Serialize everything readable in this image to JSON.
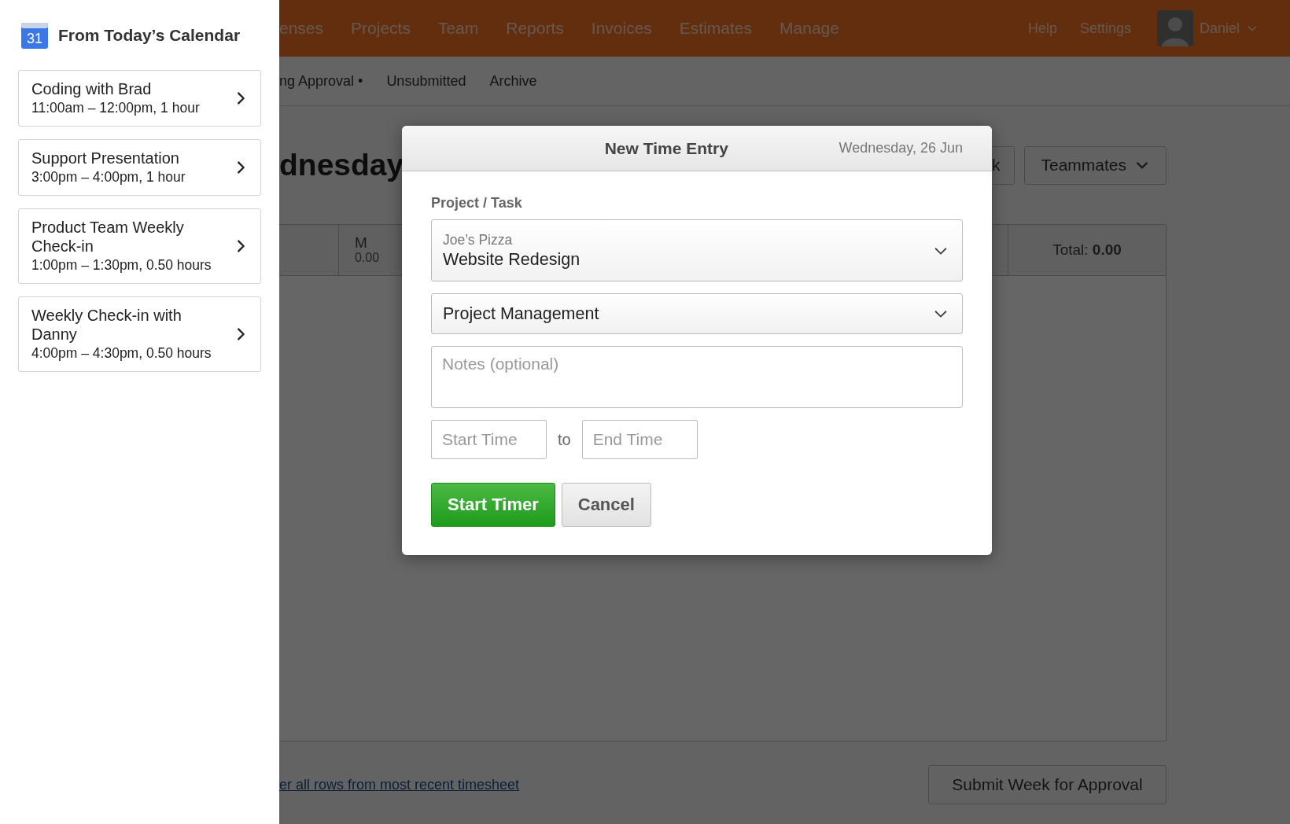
{
  "sidebar": {
    "title": "From Today’s Calendar",
    "icon_day": "31",
    "events": [
      {
        "title": "Coding with Brad",
        "time": "11:00am – 12:00pm, 1 hour"
      },
      {
        "title": "Support Presentation",
        "time": "3:00pm – 4:00pm, 1 hour"
      },
      {
        "title": "Product Team Weekly Check-in",
        "time": "1:00pm – 1:30pm, 0.50 hours"
      },
      {
        "title": "Weekly Check-in with Danny",
        "time": "4:00pm – 4:30pm, 0.50 hours"
      }
    ]
  },
  "top_nav": {
    "items": [
      "enses",
      "Projects",
      "Team",
      "Reports",
      "Invoices",
      "Estimates",
      "Manage"
    ],
    "links": [
      "Help",
      "Settings"
    ],
    "user": "Daniel"
  },
  "sub_nav": {
    "items": [
      "ng Approval •",
      "Unsubmitted",
      "Archive"
    ]
  },
  "page": {
    "heading": "dnesday",
    "buttons": [
      {
        "label": "k",
        "kind": "plain"
      },
      {
        "label": "Teammates",
        "kind": "dropdown"
      }
    ],
    "table": {
      "day": {
        "label": "M",
        "hours": "0.00"
      },
      "total": "Total: **0.00**"
    },
    "copy_link": "er all rows from most recent timesheet",
    "submit": "Submit Week for Approval"
  },
  "modal": {
    "title": "New Time Entry",
    "date": "Wednesday, 26 Jun",
    "label": "Project / Task",
    "project": {
      "client": "Joe’s Pizza",
      "name": "Website Redesign"
    },
    "task": "Project Management",
    "notes": {
      "placeholder": "Notes (optional)"
    },
    "start": {
      "placeholder": "Start Time"
    },
    "separator": "to",
    "end": {
      "placeholder": "End Time"
    },
    "primary": "Start Timer",
    "cancel": "Cancel"
  }
}
